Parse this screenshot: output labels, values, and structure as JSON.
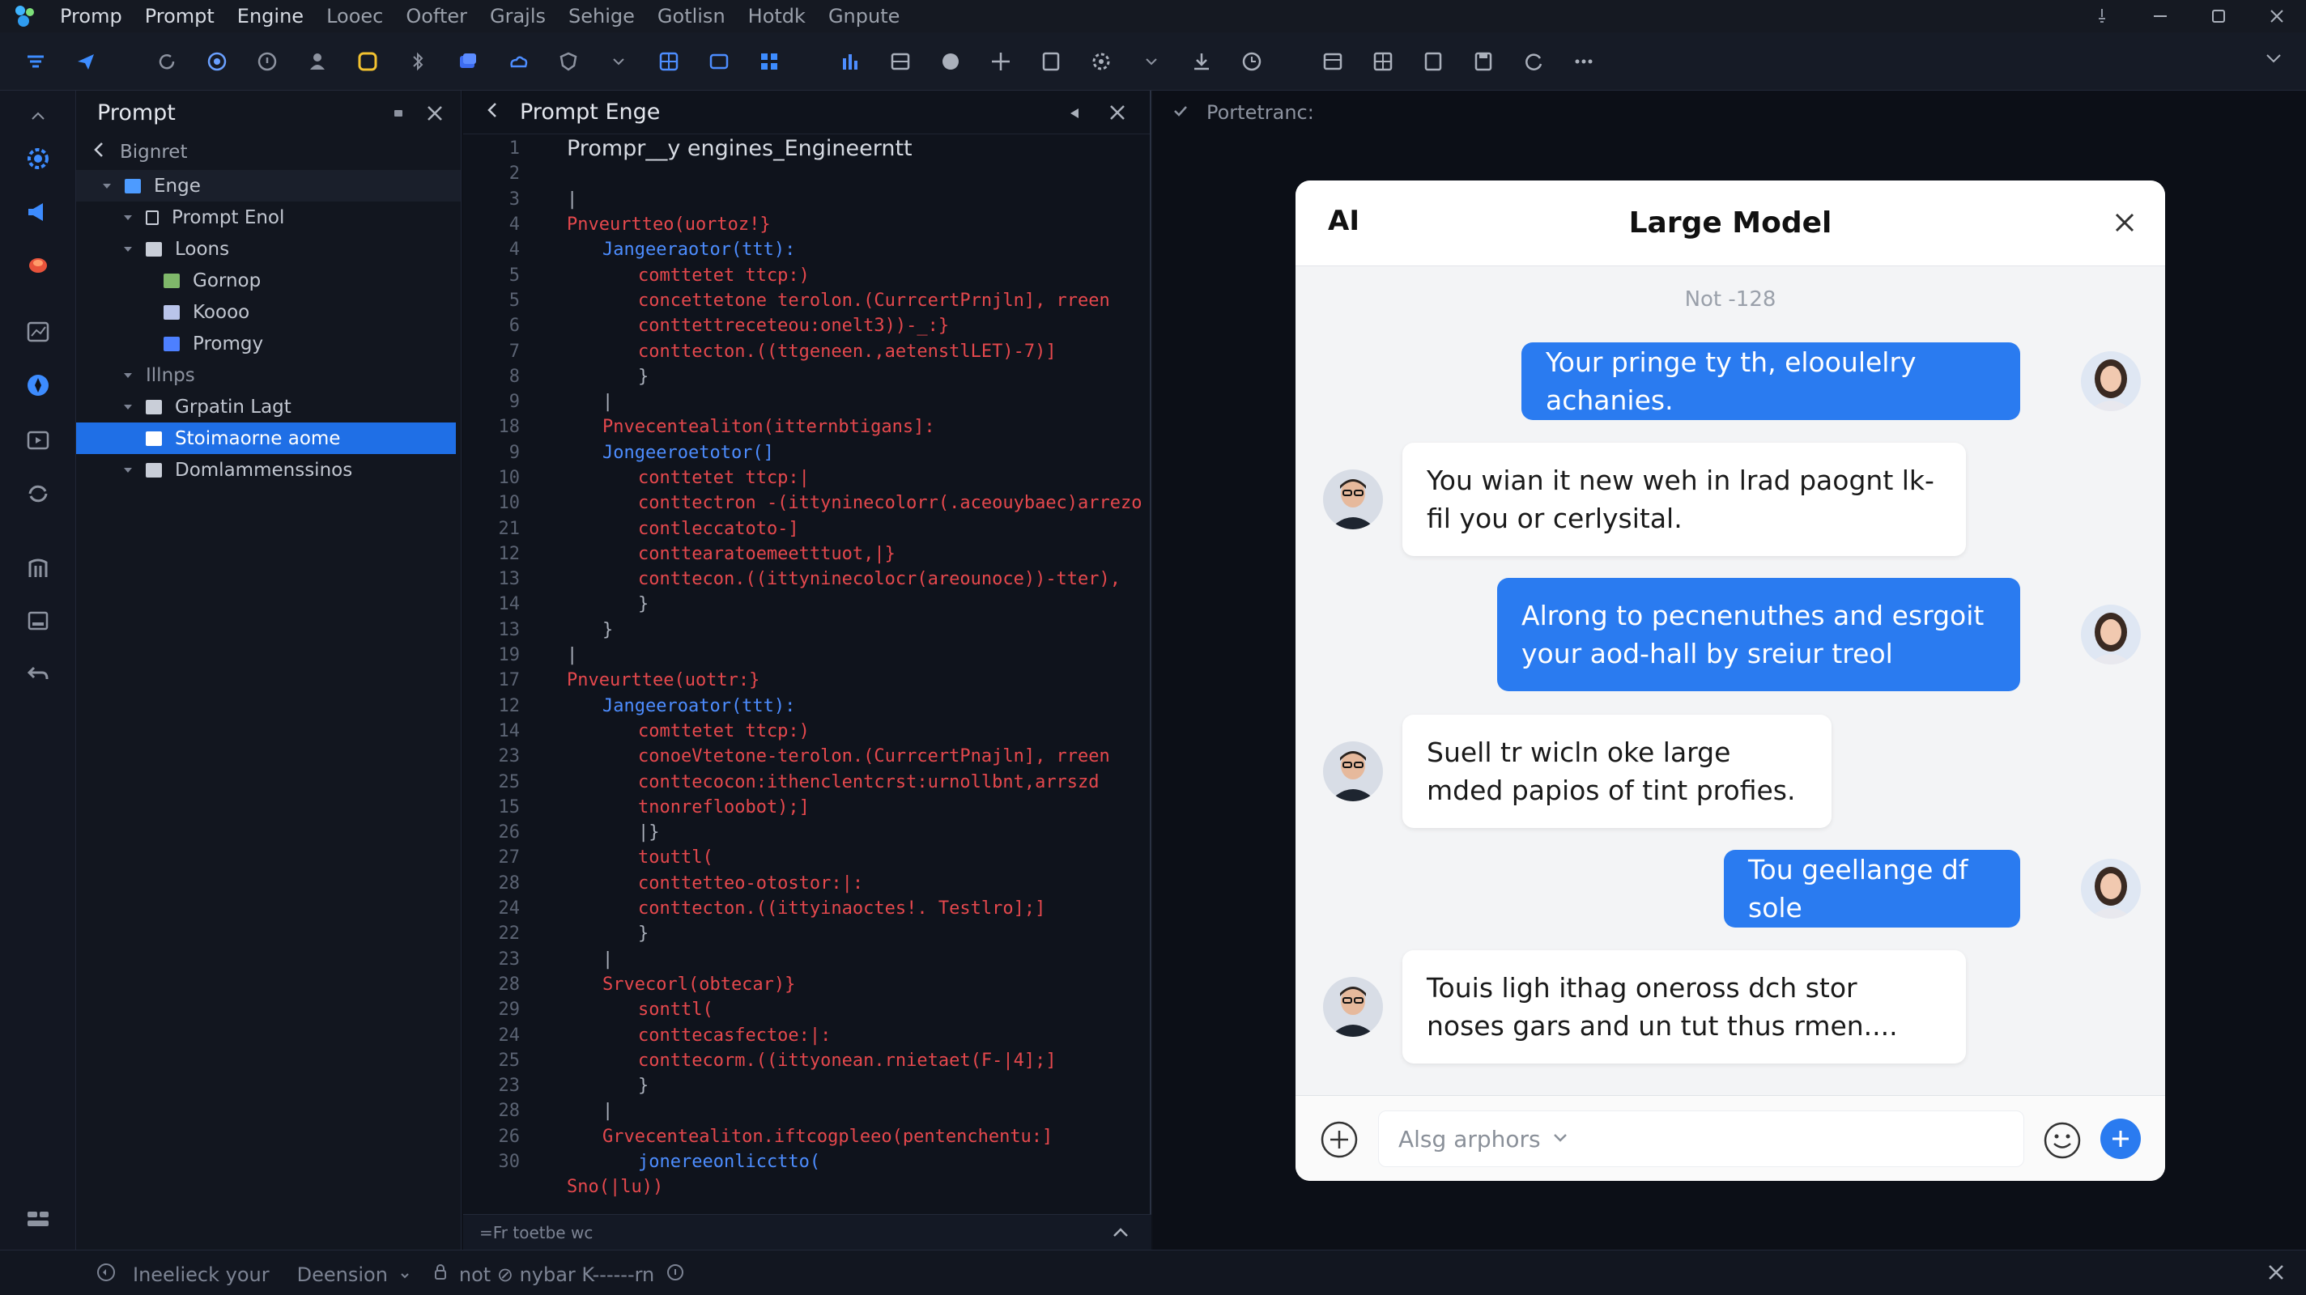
{
  "menu": {
    "items": [
      "Promp",
      "Prompt",
      "Engine",
      "Looec",
      "Oofter",
      "Grajls",
      "Sehige",
      "Gotlisn",
      "Hotdk",
      "Gnpute"
    ]
  },
  "explorer": {
    "title": "Prompt",
    "breadcrumb": "Bignret",
    "tree": [
      {
        "label": "Enge",
        "color": "#4d9bff"
      },
      {
        "label": "Prompt Enol",
        "color": "#c9ced8"
      },
      {
        "label": "Loons",
        "color": "#c9ced8"
      },
      {
        "label": "Gornop",
        "color": "#7fb86a"
      },
      {
        "label": "Koooo",
        "color": "#b9c4ea"
      },
      {
        "label": "Promgy",
        "color": "#4d80ff"
      },
      {
        "label": "Illnps",
        "color": ""
      },
      {
        "label": "Grpatin Lagt",
        "color": "#c9ced8"
      },
      {
        "label": "Stoimaorne aome",
        "color": "#ffffff"
      },
      {
        "label": "Domlammenssinos",
        "color": "#c9ced8"
      }
    ]
  },
  "editor": {
    "tab_title": "Prompt Enge",
    "line_numbers": [
      "1",
      "2",
      "3",
      "4",
      "4",
      "5",
      "5",
      "6",
      "7",
      "8",
      "9",
      "18",
      "9",
      "10",
      "10",
      "21",
      "12",
      "13",
      "14",
      "13",
      "19",
      "17",
      "12",
      "14",
      "23",
      "25",
      "15",
      "26",
      "27",
      "28",
      "24",
      "22",
      "23",
      "28",
      "29",
      "24",
      "25",
      "23",
      "28",
      "26",
      "30"
    ],
    "lines": [
      {
        "text": "Prompr__y engines_Engineerntt",
        "color": "#d6dae2",
        "indent": 0
      },
      {
        "text": "",
        "color": "#d6dae2",
        "indent": 0
      },
      {
        "text": "|",
        "color": "#aab0bb",
        "indent": 0
      },
      {
        "text": "Pnveurtteo(uortoz!}",
        "color": "#e5484d",
        "indent": 0
      },
      {
        "text": "Jangeeraotor(ttt):",
        "color": "#4d8dff",
        "indent": 1
      },
      {
        "text": "comttetet ttcp:)",
        "color": "#e5484d",
        "indent": 2
      },
      {
        "text": "concettetone terolon.(CurrcertPrnjln], rreen",
        "color": "#e5484d",
        "indent": 2
      },
      {
        "text": "conttettreceteou:onelt3))-_:}",
        "color": "#e5484d",
        "indent": 2
      },
      {
        "text": "conttecton.((ttgeneen.,aetenstlLET)-7)]",
        "color": "#e5484d",
        "indent": 2
      },
      {
        "text": "}",
        "color": "#aab0bb",
        "indent": 2
      },
      {
        "text": "|",
        "color": "#aab0bb",
        "indent": 1
      },
      {
        "text": "Pnvecentealiton(itternbtigans]:",
        "color": "#e5484d",
        "indent": 1
      },
      {
        "text": "Jongeeroetotor(]",
        "color": "#4d8dff",
        "indent": 1
      },
      {
        "text": "conttetet ttcp:|",
        "color": "#e5484d",
        "indent": 2
      },
      {
        "text": "conttectron -(ittyninecolorr(.aceouybaec)arrezo",
        "color": "#e5484d",
        "indent": 2
      },
      {
        "text": "contleccatoto-]",
        "color": "#e5484d",
        "indent": 2
      },
      {
        "text": "conttearatoemeetttuot,|}",
        "color": "#e5484d",
        "indent": 2
      },
      {
        "text": "conttecon.((ittyninecolocr(areounoce))-tter),",
        "color": "#e5484d",
        "indent": 2
      },
      {
        "text": "}",
        "color": "#aab0bb",
        "indent": 2
      },
      {
        "text": "}",
        "color": "#aab0bb",
        "indent": 1
      },
      {
        "text": "|",
        "color": "#aab0bb",
        "indent": 0
      },
      {
        "text": "Pnveurttee(uottr:}",
        "color": "#e5484d",
        "indent": 0
      },
      {
        "text": "Jangeeroator(ttt):",
        "color": "#4d8dff",
        "indent": 1
      },
      {
        "text": "comttetet ttcp:)",
        "color": "#e5484d",
        "indent": 2
      },
      {
        "text": "conoeVtetone-terolon.(CurrcertPnajln], rreen",
        "color": "#e5484d",
        "indent": 2
      },
      {
        "text": "conttecocon:ithenclentcrst:urnollbnt,arrszd",
        "color": "#e5484d",
        "indent": 2
      },
      {
        "text": "tnonrefloobot);]",
        "color": "#e5484d",
        "indent": 2
      },
      {
        "text": "|}",
        "color": "#aab0bb",
        "indent": 2
      },
      {
        "text": "touttl(",
        "color": "#e5484d",
        "indent": 2
      },
      {
        "text": "conttetteo-otostor:|:",
        "color": "#e5484d",
        "indent": 2
      },
      {
        "text": "conttecton.((ittyinaoctes!. Testlro];]",
        "color": "#e5484d",
        "indent": 2
      },
      {
        "text": "}",
        "color": "#aab0bb",
        "indent": 2
      },
      {
        "text": "|",
        "color": "#aab0bb",
        "indent": 1
      },
      {
        "text": "Srvecorl(obtecar)}",
        "color": "#e5484d",
        "indent": 1
      },
      {
        "text": "sonttl(",
        "color": "#e5484d",
        "indent": 2
      },
      {
        "text": "conttecasfectoe:|:",
        "color": "#e5484d",
        "indent": 2
      },
      {
        "text": "conttecorm.((ittyonean.rnietaet(F-|4];]",
        "color": "#e5484d",
        "indent": 2
      },
      {
        "text": "}",
        "color": "#aab0bb",
        "indent": 2
      },
      {
        "text": "|",
        "color": "#aab0bb",
        "indent": 1
      },
      {
        "text": "Grvecentealiton.iftcogpleeo(pentenchentu:]",
        "color": "#e5484d",
        "indent": 1
      },
      {
        "text": "jonereeonlicctto(",
        "color": "#4d8dff",
        "indent": 2
      },
      {
        "text": "Sno(|lu))",
        "color": "#e5484d",
        "indent": 0
      }
    ],
    "footer": "=Fr toetbe wc"
  },
  "right_panel": {
    "title": "Portetranc:"
  },
  "chat": {
    "brand": "AI",
    "title": "Large Model",
    "timestamp": "Not -128",
    "messages": [
      {
        "side": "out",
        "text": "Your pringe ty th, elooulelry achanies."
      },
      {
        "side": "in",
        "text": "You wian it new weh in lrad paognt lk-fil you or cerlysital."
      },
      {
        "side": "out",
        "text": "Alrong to pecnenuthes and esrgoit your aod-hall by sreiur treol"
      },
      {
        "side": "in",
        "text": "Suell tr wicln oke large mded papios of tint profies."
      },
      {
        "side": "out",
        "text": "Tou geellange df sole"
      },
      {
        "side": "in",
        "text": "Touis ligh ithag oneross dch stor noses gars and un tut thus rmen...."
      }
    ],
    "input_placeholder": "Alsg arphors",
    "accent": "#2a7bf0"
  },
  "statusbar": {
    "left_text": "Ineelieck your",
    "branch": "Deension",
    "extra": "not ⊘ nybar K------rn"
  },
  "colors": {
    "bg": "#0e1119",
    "panel": "#12161f",
    "selection": "#1f6fe6",
    "keyword_red": "#e5484d",
    "keyword_blue": "#4d8dff"
  }
}
